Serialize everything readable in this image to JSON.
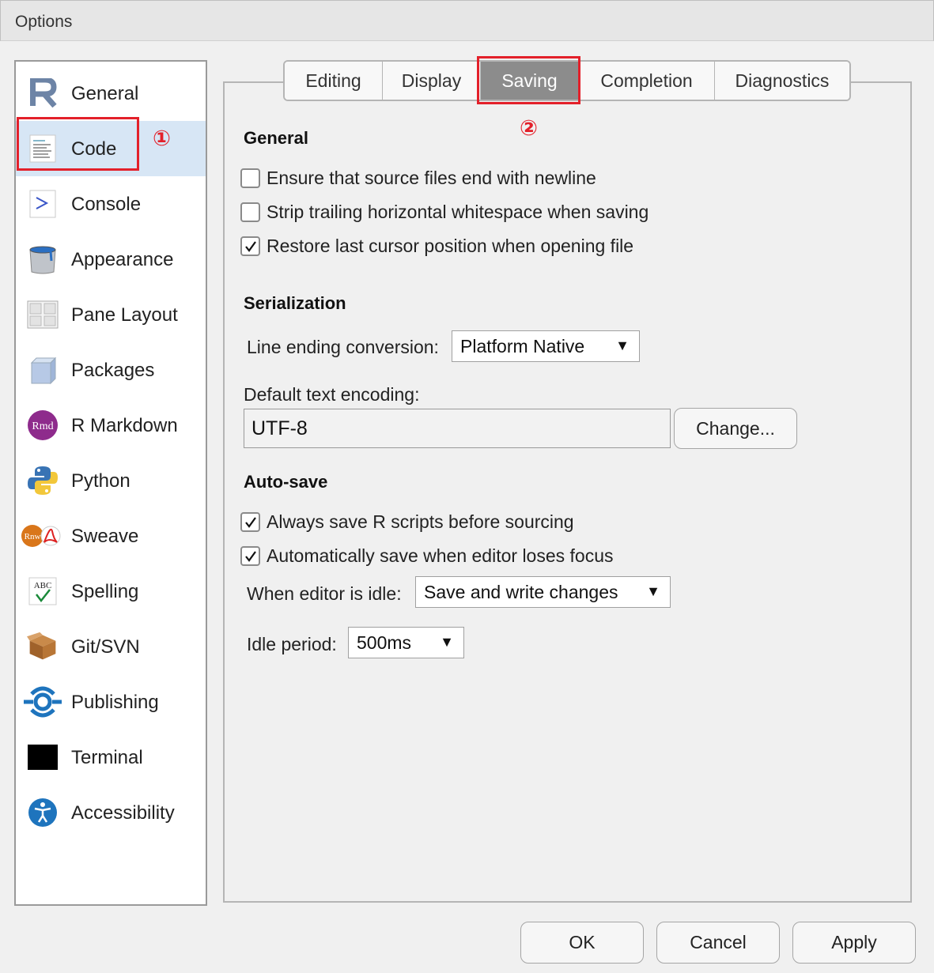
{
  "window": {
    "title": "Options"
  },
  "sidebar": {
    "items": [
      {
        "label": "General",
        "icon": "r-logo-icon"
      },
      {
        "label": "Code",
        "icon": "code-file-icon"
      },
      {
        "label": "Console",
        "icon": "console-prompt-icon"
      },
      {
        "label": "Appearance",
        "icon": "paint-bucket-icon"
      },
      {
        "label": "Pane Layout",
        "icon": "pane-grid-icon"
      },
      {
        "label": "Packages",
        "icon": "package-cube-icon"
      },
      {
        "label": "R Markdown",
        "icon": "rmd-icon"
      },
      {
        "label": "Python",
        "icon": "python-icon"
      },
      {
        "label": "Sweave",
        "icon": "sweave-icon"
      },
      {
        "label": "Spelling",
        "icon": "spelling-abc-icon"
      },
      {
        "label": "Git/SVN",
        "icon": "git-box-icon"
      },
      {
        "label": "Publishing",
        "icon": "publishing-icon"
      },
      {
        "label": "Terminal",
        "icon": "terminal-icon"
      },
      {
        "label": "Accessibility",
        "icon": "accessibility-icon"
      }
    ],
    "selected": "Code"
  },
  "annotations": {
    "marker1": "①",
    "marker2": "②"
  },
  "tabs": [
    {
      "label": "Editing"
    },
    {
      "label": "Display"
    },
    {
      "label": "Saving"
    },
    {
      "label": "Completion"
    },
    {
      "label": "Diagnostics"
    }
  ],
  "active_tab": "Saving",
  "general": {
    "title": "General",
    "options": [
      {
        "label": "Ensure that source files end with newline",
        "checked": false
      },
      {
        "label": "Strip trailing horizontal whitespace when saving",
        "checked": false
      },
      {
        "label": "Restore last cursor position when opening file",
        "checked": true
      }
    ]
  },
  "serialization": {
    "title": "Serialization",
    "line_ending_label": "Line ending conversion:",
    "line_ending_value": "Platform Native",
    "encoding_label": "Default text encoding:",
    "encoding_value": "UTF-8",
    "change_button": "Change..."
  },
  "autosave": {
    "title": "Auto-save",
    "options": [
      {
        "label": "Always save R scripts before sourcing",
        "checked": true
      },
      {
        "label": "Automatically save when editor loses focus",
        "checked": true
      }
    ],
    "idle_label": "When editor is idle:",
    "idle_value": "Save and write changes",
    "period_label": "Idle period:",
    "period_value": "500ms"
  },
  "footer": {
    "ok": "OK",
    "cancel": "Cancel",
    "apply": "Apply"
  },
  "colors": {
    "accent_red": "#e3202a",
    "selected_bg": "#d7e6f5",
    "active_tab_bg": "#8c8c8c"
  }
}
